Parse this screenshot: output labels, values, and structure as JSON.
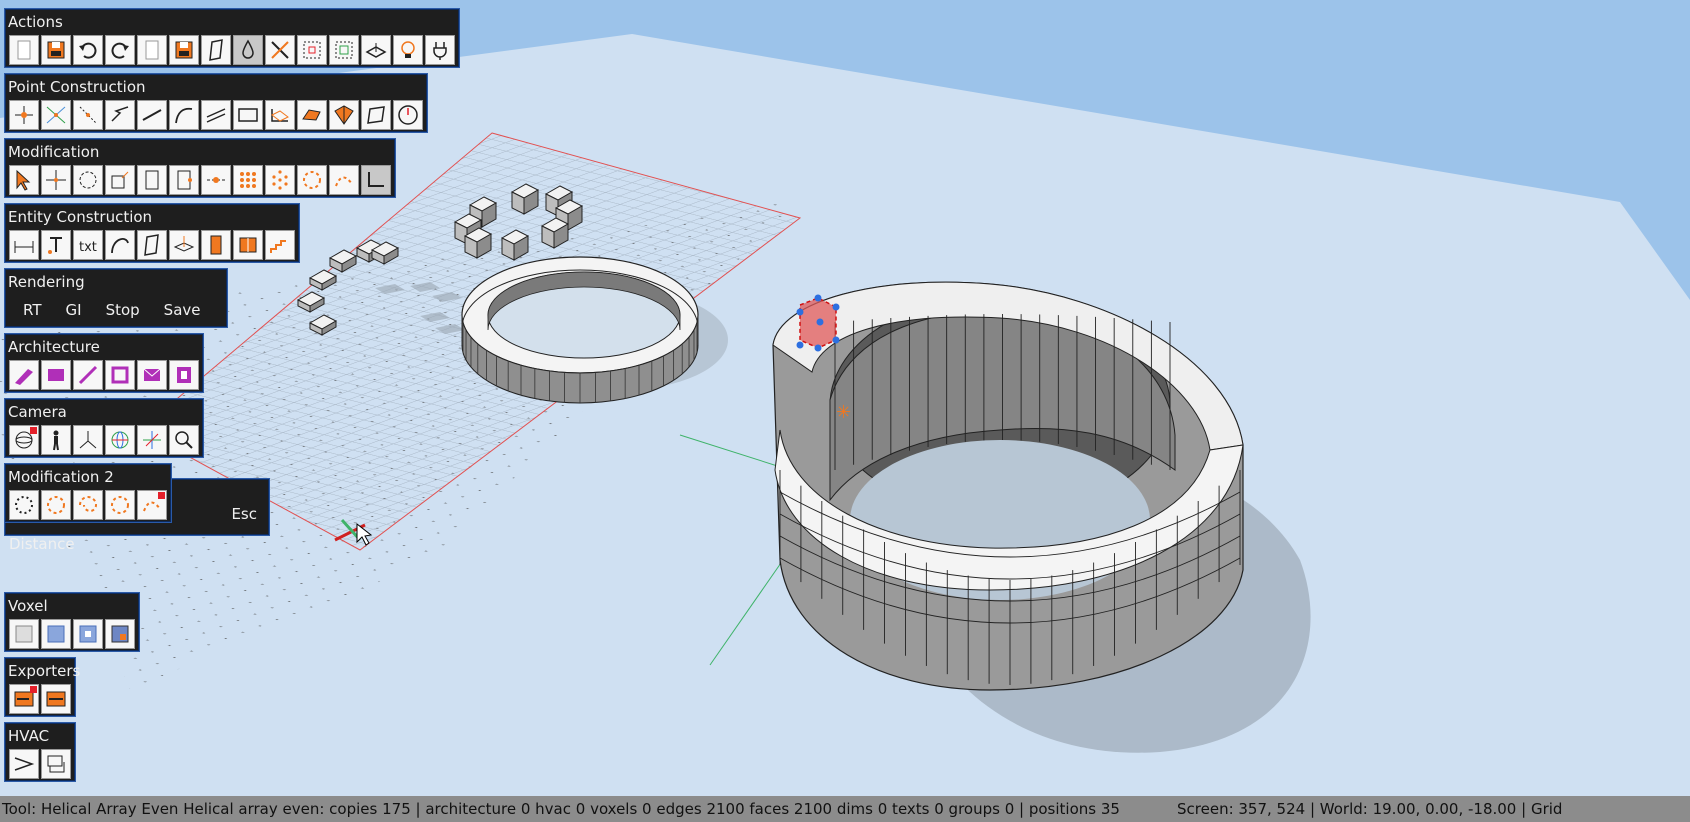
{
  "toolbars": {
    "actions": {
      "title": "Actions",
      "icons": [
        "new-file-icon",
        "save-icon",
        "undo-icon",
        "redo-icon",
        "open-file-icon",
        "save-as-icon",
        "plane-icon",
        "material-icon",
        "delete-icon",
        "select-all-icon",
        "select-region-icon",
        "ground-plane-icon",
        "light-icon",
        "plugin-icon"
      ]
    },
    "point_construction": {
      "title": "Point Construction",
      "icons": [
        "point-icon",
        "intersection-icon",
        "grid-point-icon",
        "polyline-icon",
        "line-icon",
        "arc-icon",
        "parallel-lines-icon",
        "rectangle-icon",
        "extrude-shape-icon",
        "polygon-icon",
        "triangulate-icon",
        "tilted-rect-icon",
        "clock-icon"
      ]
    },
    "modification": {
      "title": "Modification",
      "icons": [
        "select-arrow-icon",
        "move-icon",
        "rotate-icon",
        "scale-icon",
        "offset-icon",
        "push-pull-icon",
        "split-icon",
        "grid-array-icon",
        "polar-grid-icon",
        "circular-array-icon",
        "curve-array-icon",
        "fillet-icon"
      ]
    },
    "entity_construction": {
      "title": "Entity Construction",
      "icons": [
        "dimension-icon",
        "text-pin-icon",
        "text-icon",
        "curve-icon",
        "face-icon",
        "section-icon",
        "door-icon",
        "window-icon",
        "stair-icon"
      ]
    },
    "rendering": {
      "title": "Rendering",
      "buttons": [
        "RT",
        "GI",
        "Stop",
        "Save"
      ]
    },
    "architecture": {
      "title": "Architecture",
      "icons": [
        "wall-icon",
        "slab-icon",
        "beam-icon",
        "column-icon",
        "envelope-icon",
        "opening-icon"
      ]
    },
    "camera": {
      "title": "Camera",
      "icons": [
        "orbit-icon",
        "walk-icon",
        "axes-icon",
        "globe-icon",
        "pan-icon",
        "zoom-icon"
      ]
    },
    "modification2": {
      "title": "Modification 2",
      "icons": [
        "circle-array-icon",
        "helical-array-icon",
        "spiral-array-icon",
        "helical-even-icon",
        "path-array-icon"
      ]
    },
    "tool_panel": {
      "label": "Helical Array Even Distance",
      "esc": "Esc"
    },
    "voxel": {
      "title": "Voxel",
      "icons": [
        "voxel-grid-icon",
        "voxel-cube-icon",
        "voxel-block-icon",
        "voxel-select-icon"
      ]
    },
    "exporters": {
      "title": "Exporters",
      "icons": [
        "export-icon",
        "export-dwg-icon"
      ]
    },
    "hvac": {
      "title": "HVAC",
      "icons": [
        "duct-icon",
        "diffuser-icon"
      ]
    }
  },
  "status": {
    "left": "Tool: Helical Array Even Helical array even: copies 175 | architecture 0 hvac 0 voxels 0 edges 2100 faces 2100 dims 0 texts 0 groups 0 | positions 35",
    "right": "Screen: 357, 524 | World: 19.00, 0.00, -18.00 | Grid"
  },
  "colors": {
    "sky": "#9cc3ea",
    "ground": "#cfe0f2",
    "panel": "#1e1e1e",
    "panel_border": "#2a5aa8",
    "statusbar": "#8c8c8c",
    "accent_orange": "#f07820",
    "accent_red": "#e4202a",
    "arch_purple": "#b02fb8"
  }
}
